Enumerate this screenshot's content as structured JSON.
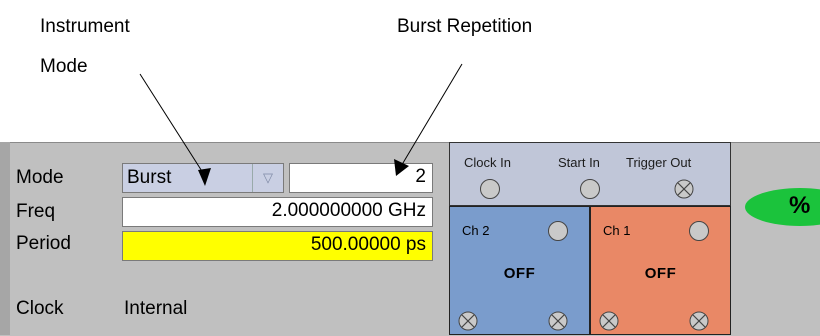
{
  "callouts": {
    "instrument_mode": "Instrument Mode",
    "instrument_mode_line1": "Instrument",
    "instrument_mode_line2": "Mode",
    "burst_repetition": "Burst Repetition"
  },
  "settings": {
    "mode_label": "Mode",
    "mode_value": "Burst",
    "burst_count": "2",
    "freq_label": "Freq",
    "freq_value": "2.000000000 GHz",
    "period_label": "Period",
    "period_value": "500.00000 ps",
    "clock_label": "Clock",
    "clock_value": "Internal"
  },
  "io": {
    "clock_in": "Clock In",
    "start_in": "Start In",
    "trigger_out": "Trigger Out"
  },
  "channels": {
    "ch2": {
      "title": "Ch 2",
      "state": "OFF"
    },
    "ch1": {
      "title": "Ch 1",
      "state": "OFF"
    }
  },
  "colors": {
    "panel": "#c0c0c0",
    "period_highlight": "#ffff00",
    "ch2": "#7a9ccc",
    "ch1": "#e98866",
    "toggle": "#1bc33c"
  },
  "icons": {
    "dropdown": "triangle-down-icon",
    "led": "circle-led-icon",
    "xled": "crossed-circle-icon"
  }
}
